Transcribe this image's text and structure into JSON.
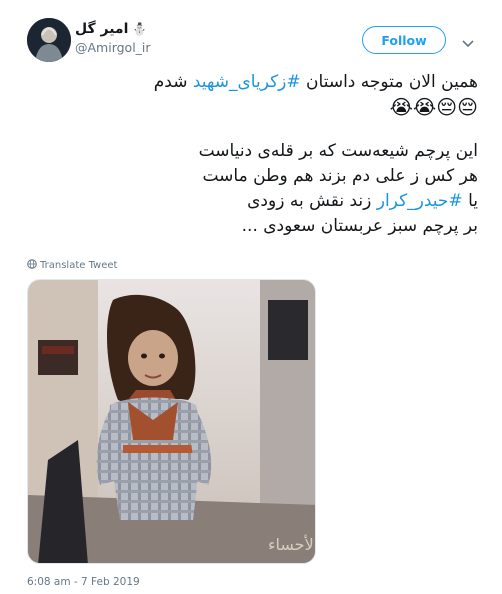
{
  "author": {
    "display_name": "امیر گل",
    "name_emoji": "⛄",
    "handle": "@Amirgol_ir"
  },
  "follow_label": "Follow",
  "tweet": {
    "line1_before": "همین الان متوجه داستان ",
    "line1_hashtag": "#زکریای_شهید",
    "line1_after": " شدم",
    "line2_emojis": "😭😭😔😔",
    "line3": "این پرچم شیعه‌ست که بر قله‌ی دنیاست",
    "line4": "هر کس ز علی دم بزند هم وطن ماست",
    "line5_before": "یا ",
    "line5_hashtag": "#حیدر_کرار",
    "line5_after": " زند نقش به زودی",
    "line6": "بر پرچم سبز عربستان سعودی ..."
  },
  "translate_label": "Translate Tweet",
  "icons": {
    "translate": "globe-icon",
    "menu": "chevron-down-icon",
    "avatar": "profile-avatar"
  },
  "timestamp": "6:08 am - 7 Feb 2019",
  "colors": {
    "accent": "#1da1f2",
    "hashtag": "#1b95e0",
    "text": "#14171a",
    "muted": "#657786"
  }
}
